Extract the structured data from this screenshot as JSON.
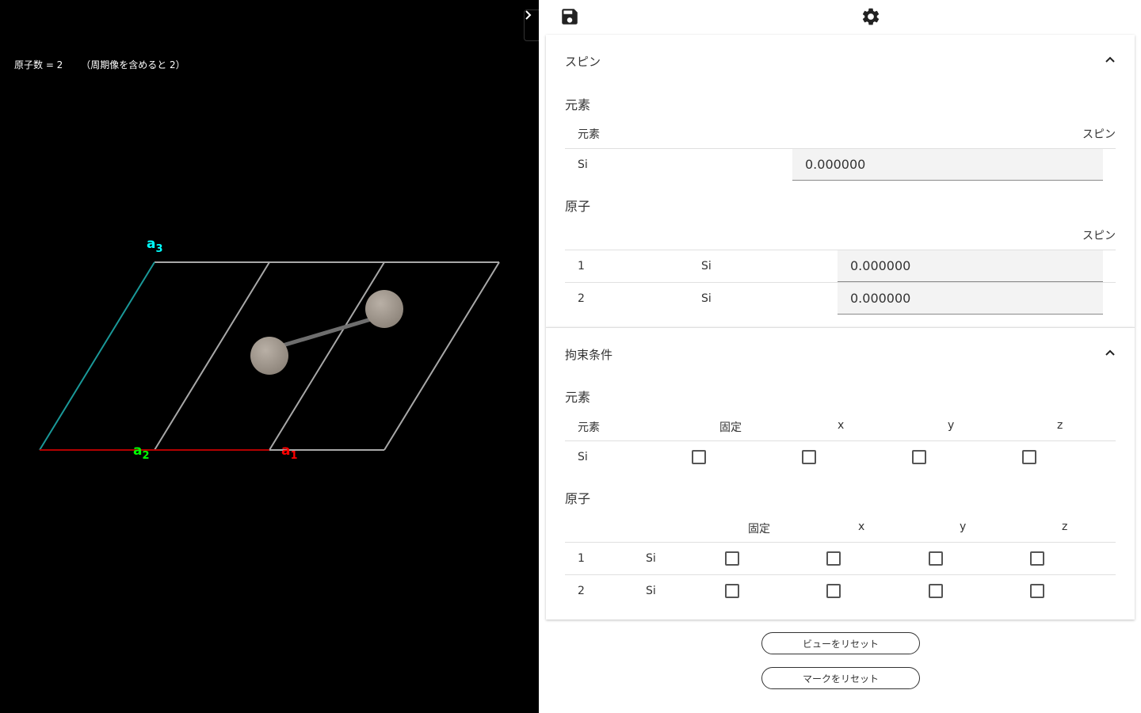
{
  "viewer": {
    "atom_count_label": "原子数 = 2",
    "atom_count_periodic": "（周期像を含めると 2）",
    "axes": {
      "a1": "a",
      "a1_sub": "1",
      "a2": "a",
      "a2_sub": "2",
      "a3": "a",
      "a3_sub": "3"
    },
    "colors": {
      "a1": "#ff0000",
      "a2": "#00ff00",
      "a3": "#00ffff",
      "cell": "#aaaaaa",
      "atom": "#a89f94"
    }
  },
  "toolbar": {
    "save_icon": "save-icon",
    "settings_icon": "gear-icon"
  },
  "spin": {
    "title": "スピン",
    "element_section": "元素",
    "element_headers": {
      "element": "元素",
      "spin": "スピン"
    },
    "element_rows": [
      {
        "element": "Si",
        "spin": "0.000000"
      }
    ],
    "atom_section": "原子",
    "atom_headers": {
      "spin": "スピン"
    },
    "atom_rows": [
      {
        "index": "1",
        "element": "Si",
        "spin": "0.000000"
      },
      {
        "index": "2",
        "element": "Si",
        "spin": "0.000000"
      }
    ]
  },
  "constraint": {
    "title": "拘束条件",
    "element_section": "元素",
    "element_headers": {
      "element": "元素",
      "fixed": "固定",
      "x": "x",
      "y": "y",
      "z": "z"
    },
    "element_rows": [
      {
        "element": "Si"
      }
    ],
    "atom_section": "原子",
    "atom_headers": {
      "fixed": "固定",
      "x": "x",
      "y": "y",
      "z": "z"
    },
    "atom_rows": [
      {
        "index": "1",
        "element": "Si"
      },
      {
        "index": "2",
        "element": "Si"
      }
    ]
  },
  "buttons": {
    "reset_view": "ビューをリセット",
    "reset_mark": "マークをリセット"
  }
}
